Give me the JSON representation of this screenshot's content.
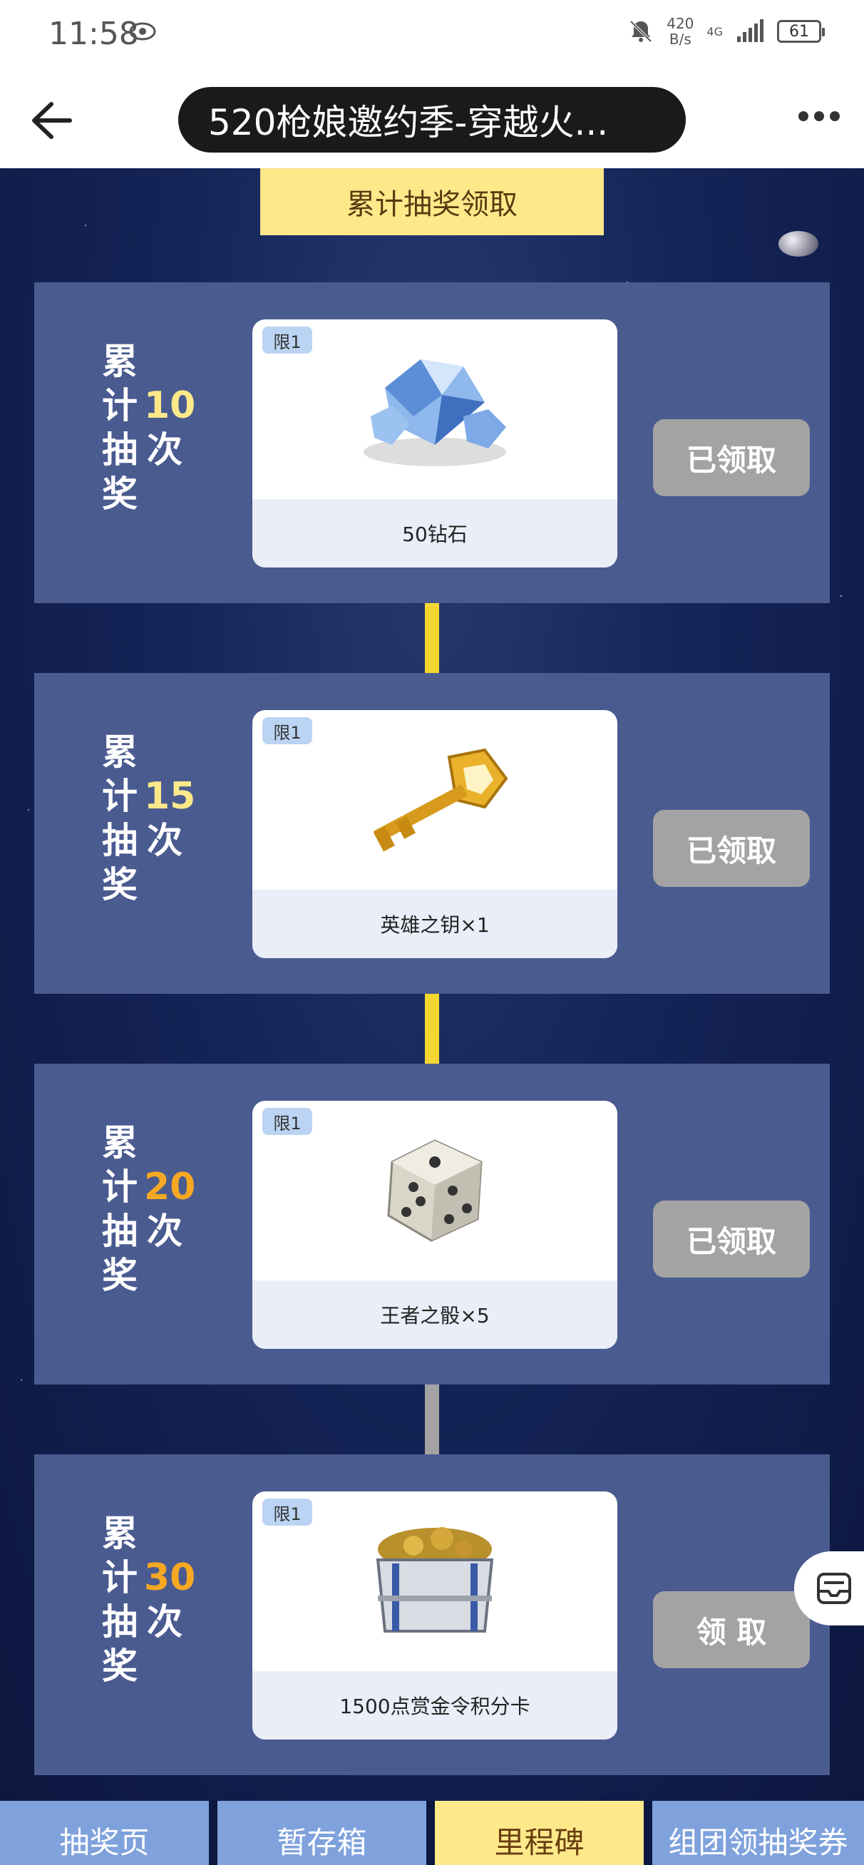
{
  "status_bar": {
    "time": "11:58",
    "speed": "420",
    "speed_unit": "B/s",
    "network": "4G",
    "battery": "61"
  },
  "title_bar": {
    "title": "520枪娘邀约季-穿越火..."
  },
  "header_tab": "累计抽奖领取",
  "milestones": [
    {
      "label_left": [
        "累",
        "计",
        "抽",
        "奖"
      ],
      "count": "10",
      "count_color": "#fde98a",
      "unit": "次",
      "badge": "限1",
      "reward": "50钻石",
      "button": "已领取",
      "art": "diamond-icon"
    },
    {
      "label_left": [
        "累",
        "计",
        "抽",
        "奖"
      ],
      "count": "15",
      "count_color": "#fde98a",
      "unit": "次",
      "badge": "限1",
      "reward": "英雄之钥×1",
      "button": "已领取",
      "art": "key-icon"
    },
    {
      "label_left": [
        "累",
        "计",
        "抽",
        "奖"
      ],
      "count": "20",
      "count_color": "#f7a823",
      "unit": "次",
      "badge": "限1",
      "reward": "王者之骰×5",
      "button": "已领取",
      "art": "dice-icon"
    },
    {
      "label_left": [
        "累",
        "计",
        "抽",
        "奖"
      ],
      "count": "30",
      "count_color": "#f7a823",
      "unit": "次",
      "badge": "限1",
      "reward": "1500点赏金令积分卡",
      "button": "领 取",
      "art": "treasure-box-icon"
    }
  ],
  "bottom_nav": {
    "tabs": [
      "抽奖页",
      "暂存箱",
      "里程碑",
      "组团领抽奖券"
    ],
    "active": "里程碑"
  },
  "colors": {
    "accent_yellow": "#fde98a",
    "card_bg": "#4a5b90",
    "button_gray": "#a3a3a3",
    "connector_done": "#f5d630",
    "connector_pending": "#a3a3a3"
  }
}
